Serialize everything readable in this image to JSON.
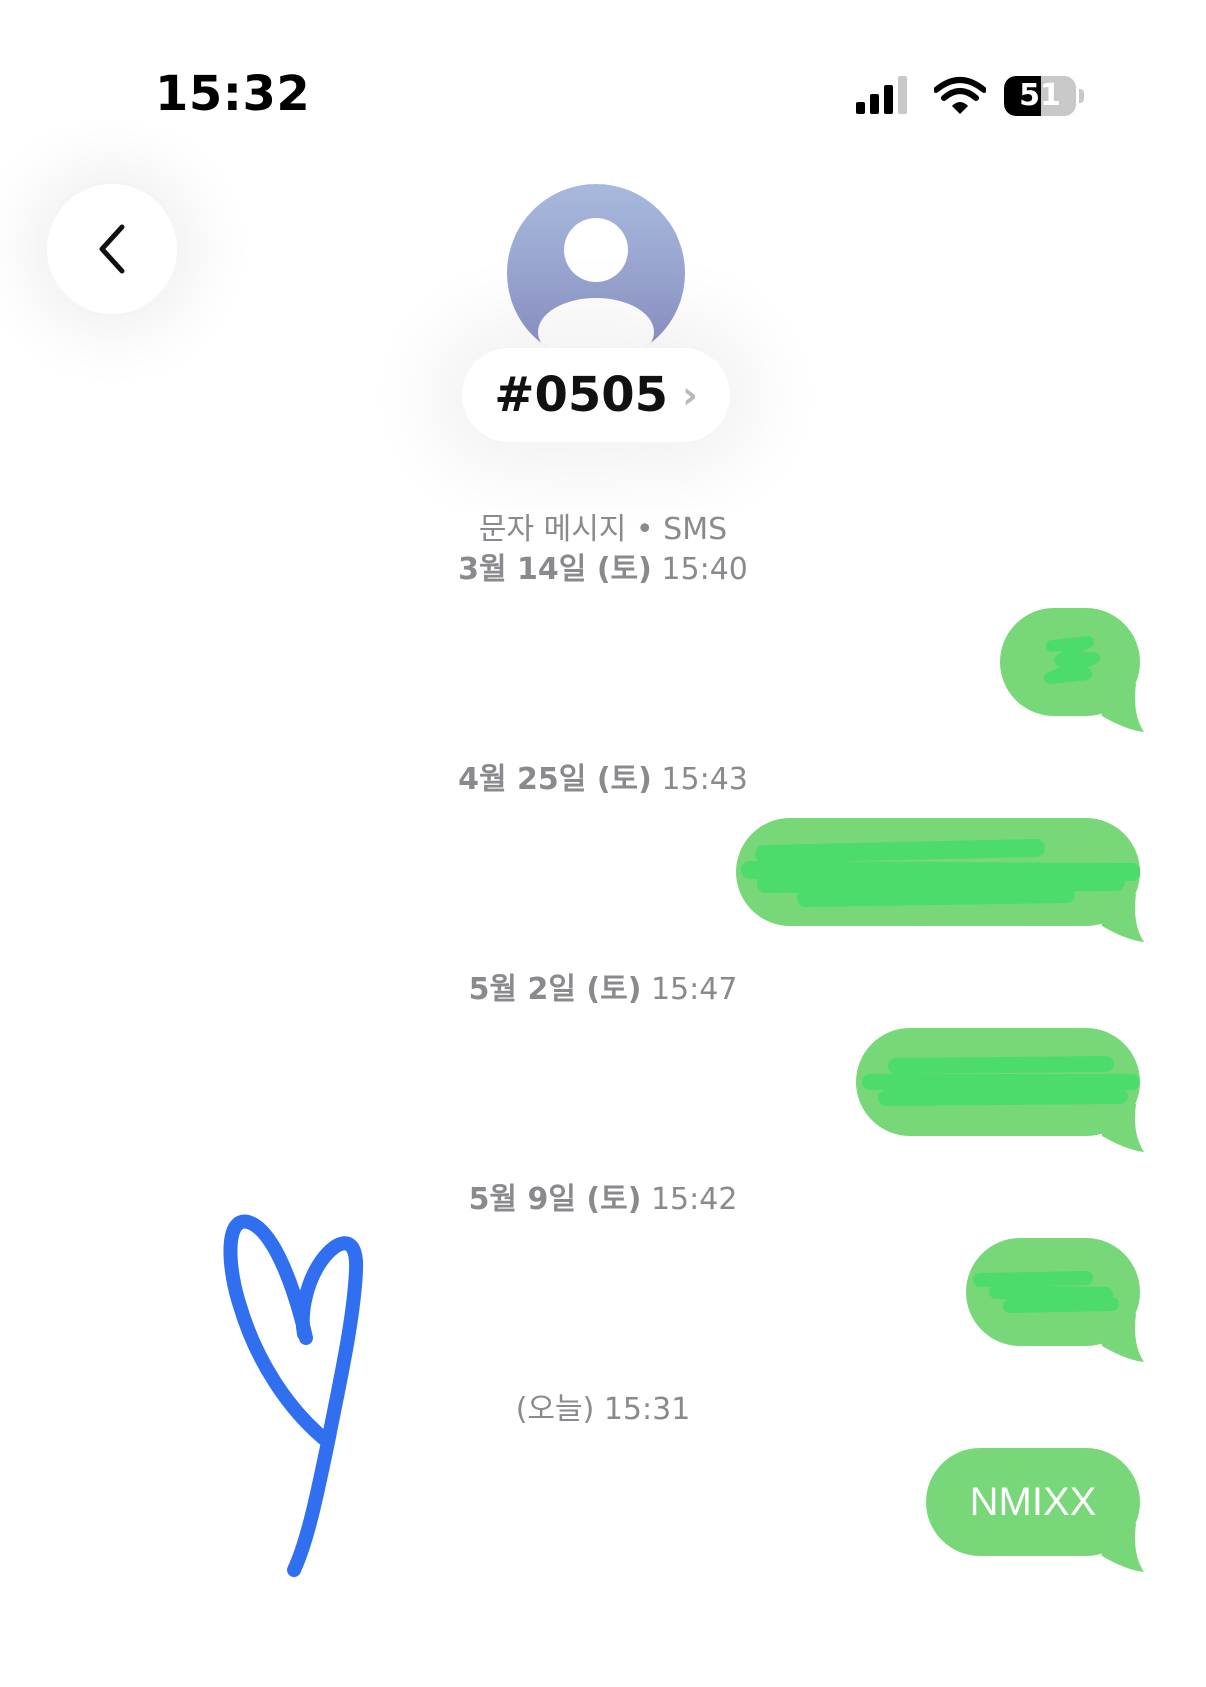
{
  "status_bar": {
    "time": "15:32",
    "battery_percent": "51",
    "battery_level": 0.51,
    "icons": [
      "signal-icon",
      "wifi-icon",
      "battery-icon"
    ]
  },
  "header": {
    "back_icon": "chevron-left-icon",
    "avatar_icon": "person-icon",
    "contact_name": "#0505",
    "contact_chevron": "›"
  },
  "conversation": {
    "service_label": "문자 메시지 • SMS",
    "entries": [
      {
        "timestamp_date": "3월 14일 (토)",
        "timestamp_time": "15:40",
        "message_text": ""
      },
      {
        "timestamp_date": "4월 25일 (토)",
        "timestamp_time": "15:43",
        "message_text": ""
      },
      {
        "timestamp_date": "5월 2일 (토)",
        "timestamp_time": "15:47",
        "message_text": ""
      },
      {
        "timestamp_date": "5월 9일 (토)",
        "timestamp_time": "15:42",
        "message_text": ""
      },
      {
        "timestamp_date": "(오늘)",
        "timestamp_time": "15:31",
        "message_text": "NMIXX"
      }
    ]
  },
  "colors": {
    "bubble_green": "#78d778",
    "redaction_green": "#4cdc6c",
    "timestamp_gray": "#8a8a8e",
    "doodle_blue": "#2f6ff0"
  }
}
